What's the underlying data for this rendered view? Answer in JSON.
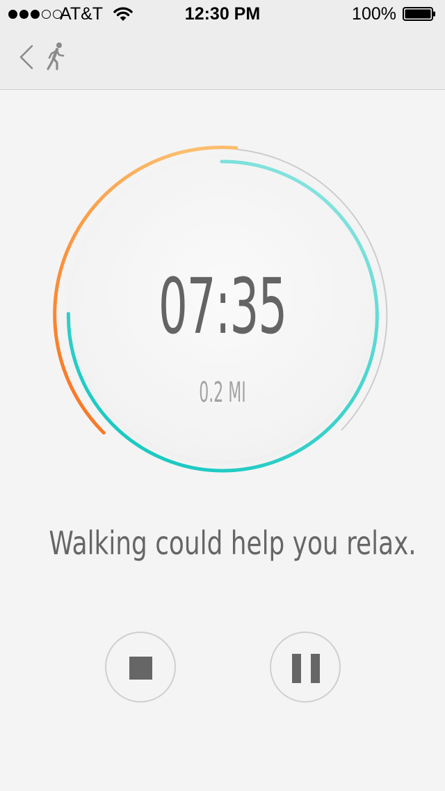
{
  "status_bar": {
    "signal_dots": {
      "filled": 3,
      "empty": 2
    },
    "carrier": "AT&T",
    "wifi_icon": "wifi-icon",
    "time": "12:30 PM",
    "battery_percent": "100%",
    "battery_icon": "battery-icon"
  },
  "nav": {
    "back_icon": "chevron-left-icon",
    "activity_icon": "walking-person-icon"
  },
  "workout": {
    "elapsed_time": "07:35",
    "distance": "0.2 MI",
    "message": "Walking could help you relax."
  },
  "controls": {
    "stop_icon": "stop-icon",
    "pause_icon": "pause-icon"
  },
  "colors": {
    "background": "#f4f4f4",
    "header_background": "#ededed",
    "text": "#666666",
    "muted_text": "#a2a2a2",
    "inner_ring_teal_start": "#14c8c0",
    "inner_ring_teal_end": "#8ee4e0",
    "outer_ring_orange_start": "#fa6e1e",
    "outer_ring_orange_end": "#fbbe6e",
    "track_gray": "#cccccc"
  }
}
